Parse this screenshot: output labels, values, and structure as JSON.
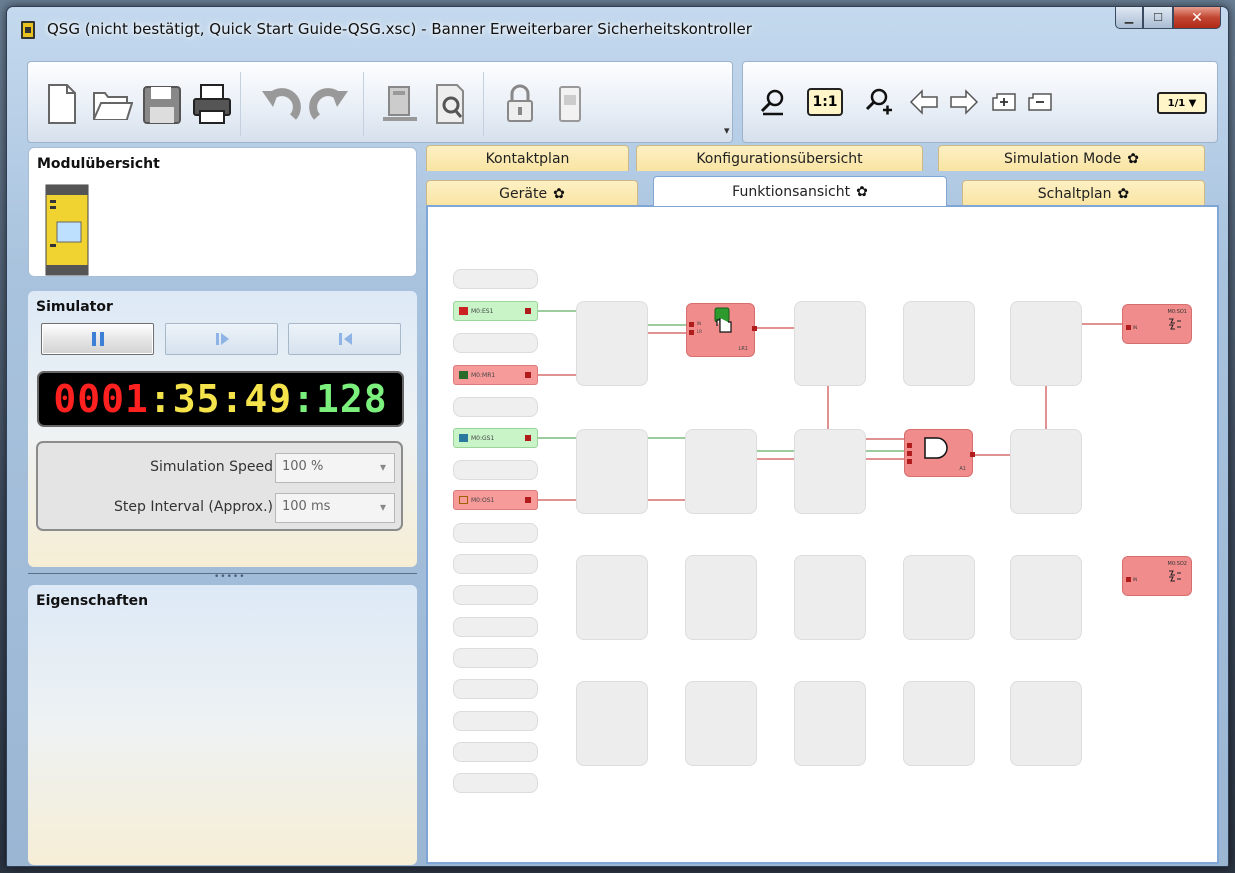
{
  "window": {
    "title": "QSG (nicht bestätigt, Quick Start Guide-QSG.xsc) - Banner Erweiterbarer Sicherheitskontroller",
    "controls": {
      "minimize": "▁",
      "maximize": "☐",
      "close": "✕"
    }
  },
  "toolbar": {
    "left_buttons": [
      "new-file-icon",
      "open-folder-icon",
      "save-icon",
      "print-icon",
      "undo-icon",
      "redo-icon",
      "network-icon",
      "inspect-icon",
      "lock-icon",
      "module-icon"
    ],
    "overflow": "▾",
    "zoom_fit": "1:1",
    "page_selector": "1/1 ▼"
  },
  "module_overview": {
    "title": "Modulübersicht"
  },
  "simulator": {
    "title": "Simulator",
    "clock": {
      "part1": "0001",
      "sep": ":",
      "part2": "35",
      "part3": "49",
      "part4": "128"
    },
    "speed_label": "Simulation Speed",
    "speed_value": "100 %",
    "interval_label": "Step Interval (Approx.)",
    "interval_value": "100 ms"
  },
  "splitter": {
    "grip": "•••••"
  },
  "properties": {
    "title": "Eigenschaften"
  },
  "tabs": {
    "row1": [
      "Kontaktplan",
      "Konfigurationsübersicht",
      "Simulation Mode"
    ],
    "row2": [
      "Geräte",
      "Funktionsansicht",
      "Schaltplan"
    ],
    "gear": "✿",
    "active": "Funktionsansicht"
  },
  "canvas": {
    "inputs": [
      "M0:ES1",
      "M0:MR1",
      "M0:GS1",
      "M0:OS1"
    ],
    "blocks": {
      "reset_label": "LR1",
      "and_label": "A1"
    },
    "outputs": [
      {
        "label": "M0:SO1",
        "in_label": "IN"
      },
      {
        "label": "M0:SO2",
        "in_label": "IN"
      }
    ],
    "reset_ports": [
      "IN",
      "LR"
    ]
  },
  "colors": {
    "active_input": "#c8f4c8",
    "inactive": "#f79a9a",
    "wire_green": "#3a9a3a",
    "wire_red": "#c22626",
    "tab": "#f9e4a2"
  }
}
